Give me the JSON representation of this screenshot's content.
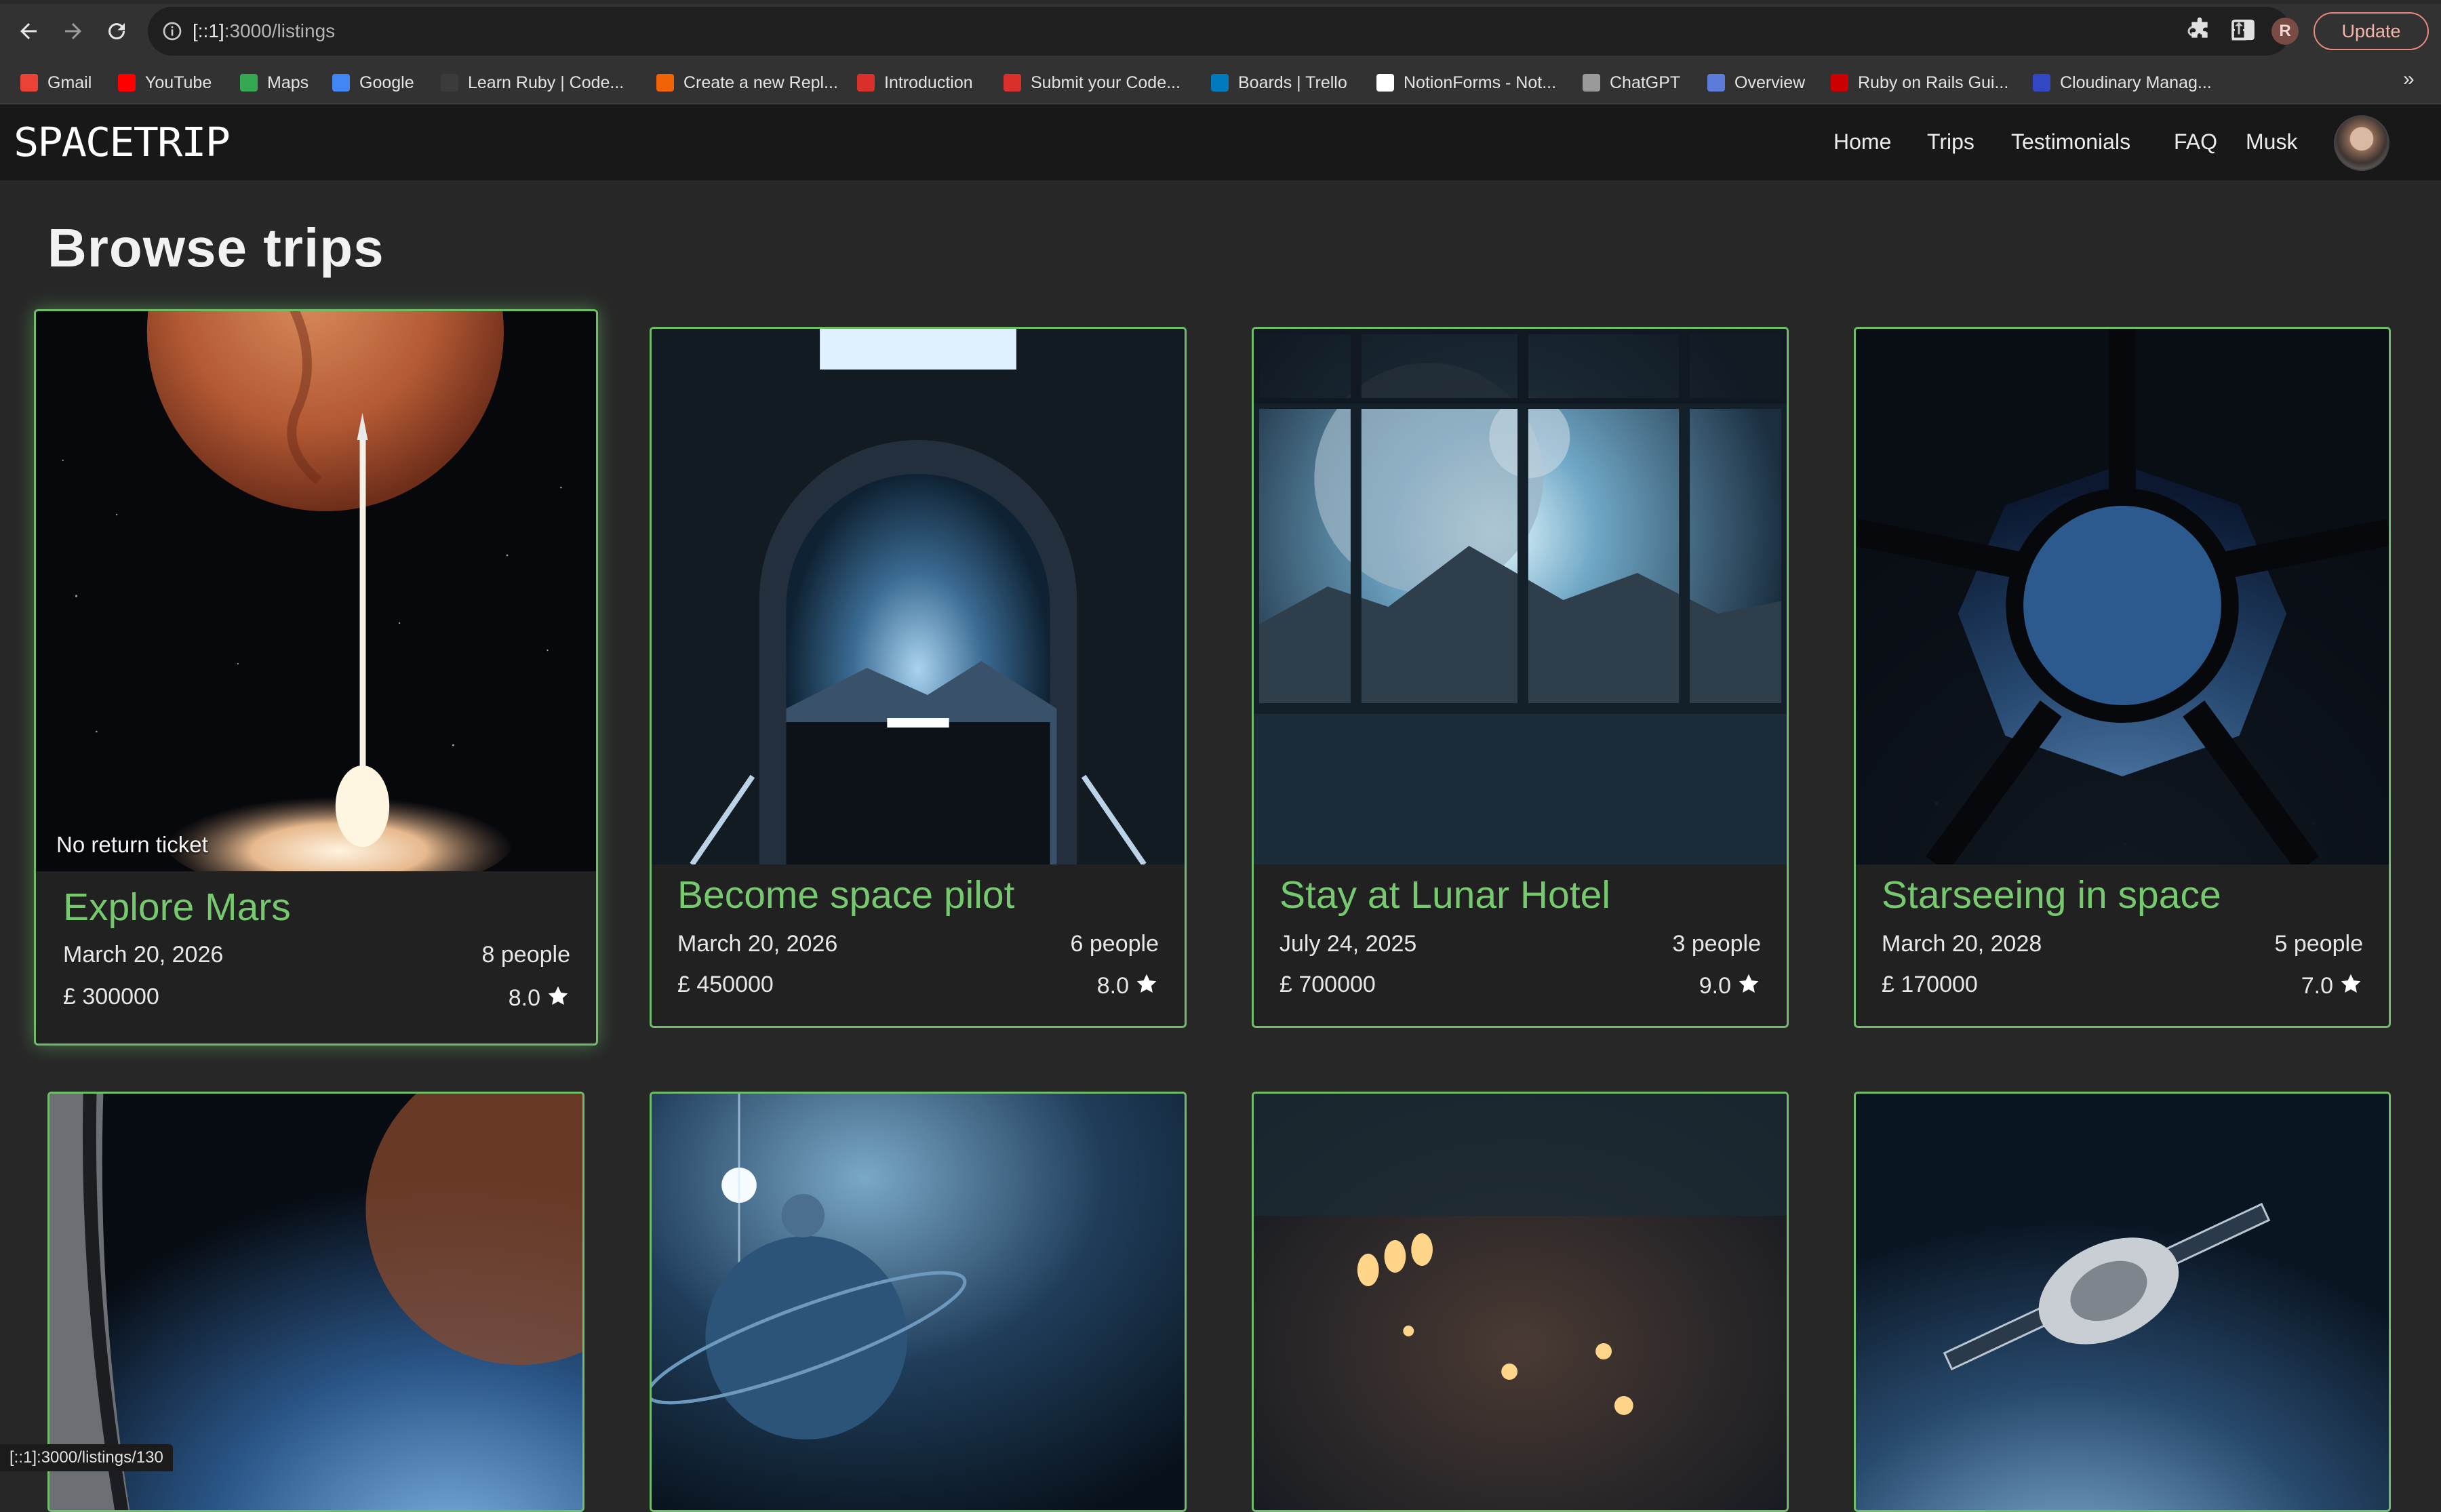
{
  "browser": {
    "url_host": "[::1]",
    "url_path": ":3000/listings",
    "profile_initial": "R",
    "update_label": "Update",
    "status_url": "[::1]:3000/listings/130",
    "bookmarks": [
      {
        "label": "Gmail",
        "color": "#ea4335"
      },
      {
        "label": "YouTube",
        "color": "#ff0000"
      },
      {
        "label": "Maps",
        "color": "#34a853"
      },
      {
        "label": "Google",
        "color": "#4285f4"
      },
      {
        "label": "Learn Ruby | Code...",
        "color": "#3b3b3b"
      },
      {
        "label": "Create a new Repl...",
        "color": "#f26207"
      },
      {
        "label": "Introduction",
        "color": "#d9302c"
      },
      {
        "label": "Submit your Code...",
        "color": "#d9302c"
      },
      {
        "label": "Boards | Trello",
        "color": "#0079bf"
      },
      {
        "label": "NotionForms - Not...",
        "color": "#ffffff"
      },
      {
        "label": "ChatGPT",
        "color": "#9a9a9a"
      },
      {
        "label": "Overview",
        "color": "#5b7cd9"
      },
      {
        "label": "Ruby on Rails Gui...",
        "color": "#cc0000"
      },
      {
        "label": "Cloudinary Manag...",
        "color": "#3448c5"
      }
    ]
  },
  "site": {
    "logo": "SPACETRIP",
    "nav": [
      "Home",
      "Trips",
      "Testimonials",
      "FAQ",
      "Musk"
    ]
  },
  "page": {
    "title": "Browse trips"
  },
  "listings": [
    {
      "title": "Explore Mars",
      "date": "March 20, 2026",
      "people": "8 people",
      "price": "£ 300000",
      "rating": "8.0",
      "badge": "No return ticket"
    },
    {
      "title": "Become space pilot",
      "date": "March 20, 2026",
      "people": "6 people",
      "price": "£ 450000",
      "rating": "8.0"
    },
    {
      "title": "Stay at Lunar Hotel",
      "date": "July 24, 2025",
      "people": "3 people",
      "price": "£ 700000",
      "rating": "9.0"
    },
    {
      "title": "Starseeing in space",
      "date": "March 20, 2028",
      "people": "5 people",
      "price": "£ 170000",
      "rating": "7.0"
    }
  ],
  "colors": {
    "accent_green": "#76c96e",
    "card_border": "#6fbd69",
    "page_bg": "#272727",
    "navbar_bg": "#181818"
  }
}
